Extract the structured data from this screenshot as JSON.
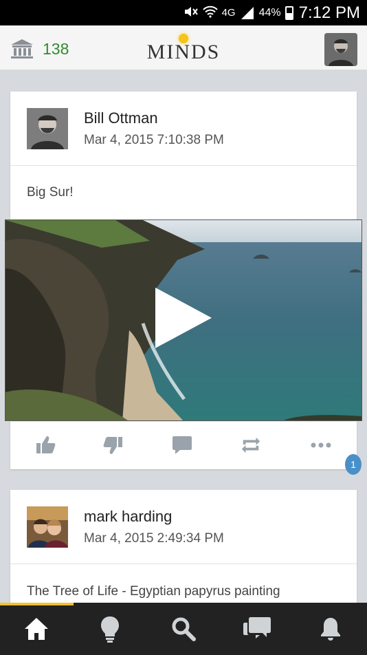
{
  "status_bar": {
    "network": "4G",
    "battery": "44%",
    "time": "7:12 PM"
  },
  "header": {
    "points": "138",
    "logo": "MINDS"
  },
  "posts": [
    {
      "author": "Bill Ottman",
      "date": "Mar 4, 2015 7:10:38 PM",
      "text": "Big Sur!"
    },
    {
      "author": "mark harding",
      "date": "Mar 4, 2015 2:49:34 PM",
      "text": "The Tree of Life - Egyptian papyrus painting"
    }
  ],
  "actions": {
    "comment_count": "1"
  },
  "icons": {
    "bank": "bank-icon",
    "thumbs_up": "thumbs-up-icon",
    "thumbs_down": "thumbs-down-icon",
    "comment": "comment-icon",
    "remind": "remind-icon",
    "more": "more-icon",
    "play": "play-icon",
    "home": "home-icon",
    "bulb": "bulb-icon",
    "search": "search-icon",
    "chat": "chat-icon",
    "bell": "bell-icon"
  },
  "colors": {
    "points": "#2e8b2e",
    "logo_bulb": "#f5c41a",
    "badge": "#4a90c8",
    "nav_bg": "#222222",
    "nav_indicator": "#f2c12e"
  }
}
